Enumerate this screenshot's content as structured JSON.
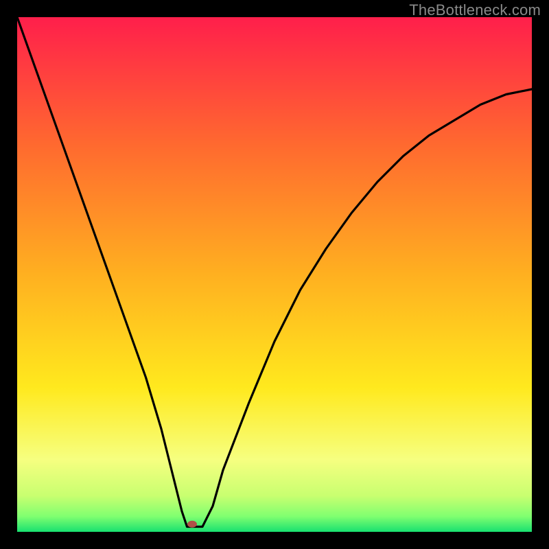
{
  "watermark": "TheBottleneck.com",
  "chart_data": {
    "type": "line",
    "title": "",
    "xlabel": "",
    "ylabel": "",
    "xlim": [
      0,
      100
    ],
    "ylim": [
      0,
      100
    ],
    "grid": false,
    "legend": false,
    "description": "V-shaped bottleneck curve plotted over a vertical rainbow gradient background (green at bottom → red at top), surrounded by a thick black frame.",
    "series": [
      {
        "name": "bottleneck-curve",
        "x": [
          0,
          5,
          10,
          15,
          20,
          25,
          28,
          30,
          32,
          33,
          34,
          36,
          38,
          40,
          45,
          50,
          55,
          60,
          65,
          70,
          75,
          80,
          85,
          90,
          95,
          100
        ],
        "values": [
          100,
          86,
          72,
          58,
          44,
          30,
          20,
          12,
          4,
          1,
          1,
          1,
          5,
          12,
          25,
          37,
          47,
          55,
          62,
          68,
          73,
          77,
          80,
          83,
          85,
          86
        ]
      }
    ],
    "marker": {
      "x": 34,
      "y": 1.5,
      "color": "#b05048",
      "rx": 7,
      "ry": 5
    },
    "gradient_stops": [
      {
        "offset": 0.0,
        "color": "#ff1f4b"
      },
      {
        "offset": 0.25,
        "color": "#ff6a2f"
      },
      {
        "offset": 0.5,
        "color": "#ffb020"
      },
      {
        "offset": 0.72,
        "color": "#ffe91e"
      },
      {
        "offset": 0.86,
        "color": "#f6ff80"
      },
      {
        "offset": 0.93,
        "color": "#c8ff70"
      },
      {
        "offset": 0.97,
        "color": "#80ff70"
      },
      {
        "offset": 1.0,
        "color": "#18e070"
      }
    ],
    "frame": {
      "outer_size": 800,
      "border_width": 25,
      "border_color": "#000000"
    }
  }
}
